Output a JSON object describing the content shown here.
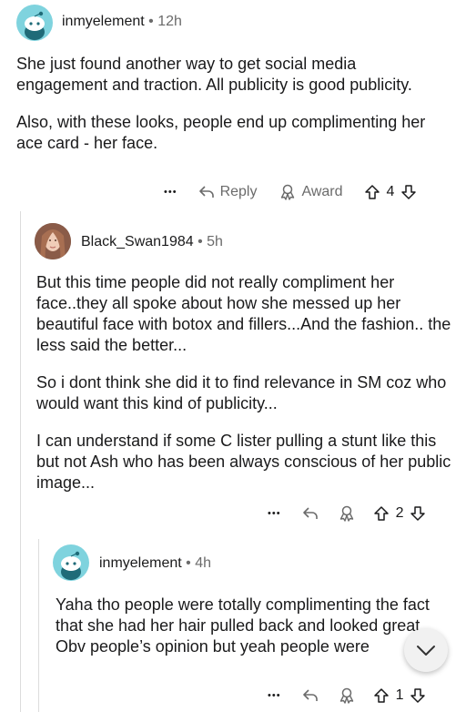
{
  "comments": [
    {
      "username": "inmyelement",
      "sep": "•",
      "time": "12h",
      "paragraphs": [
        "She just found another way to get social media engagement and traction. All publicity is good publicity.",
        "Also, with these looks, people end up complimenting her ace card - her face."
      ],
      "more": "•••",
      "reply_label": "Reply",
      "award_label": "Award",
      "score": "4"
    },
    {
      "username": "Black_Swan1984",
      "sep": "•",
      "time": "5h",
      "paragraphs": [
        "But this time people did not really compliment her face..they all spoke about how she messed up her beautiful face with botox and fillers...And the fashion.. the less said the better...",
        "So i dont think she did it to find relevance in SM coz who would want this kind of publicity...",
        "I can understand if some C lister pulling a stunt like this but not Ash who has been always conscious of her public image..."
      ],
      "more": "•••",
      "score": "2"
    },
    {
      "username": "inmyelement",
      "sep": "•",
      "time": "4h",
      "paragraphs": [
        "Yaha tho people were totally complimenting the fact that she had her hair pulled back and looked great. Obv people’s opinion but yeah people were complimenting her for basic things"
      ],
      "more": "•••",
      "score": "1"
    }
  ],
  "icons": {
    "avatar_default": "snoo-avatar-icon",
    "avatar_photo": "profile-photo",
    "reply": "reply-arrow-icon",
    "award": "award-icon",
    "upvote": "upvote-arrow-icon",
    "downvote": "downvote-arrow-icon",
    "scroll": "chevron-down-icon"
  },
  "colors": {
    "avatar_bg": "#7fd3de",
    "meta_gray": "#6b6b6b",
    "text": "#1a1a1b"
  }
}
